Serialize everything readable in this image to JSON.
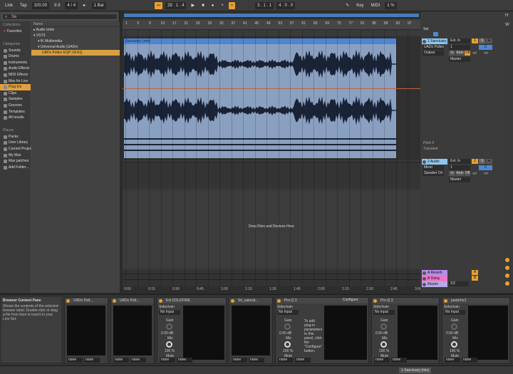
{
  "topbar": {
    "link": "Link",
    "tap": "Tap",
    "tempo": "100.00",
    "loop_icon": "II II",
    "signature": "4 / 4",
    "metro": "●·",
    "quant": "1 Bar",
    "position": "29 . 1 . 4",
    "loop_start": "3 . 1 . 1",
    "loop_len": "4 . 0 . 0",
    "key": "Key",
    "midi": "MIDI",
    "cpu": "1 %",
    "h": "H",
    "w": "W"
  },
  "browser": {
    "search_value": "Se",
    "collections_title": "Collections",
    "collections": [
      "Favorites"
    ],
    "categories_title": "Categories",
    "categories": [
      "Sounds",
      "Drums",
      "Instruments",
      "Audio Effects",
      "MIDI Effects",
      "Max for Live",
      "Plug-Ins",
      "Clips",
      "Samples",
      "Grooves",
      "Templates",
      "All results"
    ],
    "selected_category": "Plug-Ins",
    "places_title": "Places",
    "places": [
      "Packs",
      "User Library",
      "Current Project",
      "My Max",
      "Max patches",
      "Add Folder..."
    ],
    "tree_header": "Name",
    "tree": [
      {
        "label": "▸ Audio Units",
        "indent": 0
      },
      {
        "label": "▾ VST3",
        "indent": 0
      },
      {
        "label": "▾ IK Multimedia",
        "indent": 1
      },
      {
        "label": "▾ Universal Audio (UADx)",
        "indent": 1
      },
      {
        "label": "UADx Pultec EQP-1A EQ",
        "indent": 2,
        "selected": true
      }
    ]
  },
  "arrangement": {
    "bars": [
      "1",
      "5",
      "9",
      "13",
      "17",
      "21",
      "25",
      "29",
      "33",
      "37",
      "41",
      "45",
      "49",
      "53",
      "57",
      "61",
      "65",
      "69",
      "73",
      "77",
      "81",
      "85",
      "89",
      "93",
      "97"
    ],
    "clip_name": "Sanctuary (mix)",
    "drop_message": "Drop Files and Devices Here",
    "time_ticks": [
      "0:00",
      "0:15",
      "0:30",
      "0:45",
      "1:00",
      "1:15",
      "1:30",
      "1:45",
      "2:00",
      "2:15",
      "2:30",
      "2:45",
      "3:00"
    ]
  },
  "mixer": {
    "set_label": "Set",
    "track1": {
      "name": "1 Sanctuary",
      "io_in": "Ext. In",
      "device": "UADx Pultec",
      "ch": "1",
      "output": "Output",
      "in_auto": [
        "In",
        "Auto",
        "Off"
      ],
      "dest": "Master",
      "inf1": "-inf",
      "inf2": "-inf",
      "num": "1",
      "s": "S",
      "c": "C",
      "sub1": "Pitch 0",
      "sub2": "Transient"
    },
    "track2": {
      "name": "2 Audio",
      "io_in": "Ext. In",
      "device": "Mixer",
      "ch": "1",
      "output": "Speaker On",
      "in_auto": [
        "In",
        "Auto",
        "Off"
      ],
      "dest": "Master",
      "inf1": "-inf",
      "inf2": "-inf",
      "num": "2",
      "s": "S",
      "c": "C"
    },
    "returns": [
      {
        "name": "A Reverb",
        "letter": "A"
      },
      {
        "name": "B Delay",
        "letter": "B"
      },
      {
        "name": "Master",
        "letter": "1/2"
      }
    ],
    "colors": {
      "track1": "#8ec6f0",
      "track2": "#8ec6f0",
      "returnA": "#b88de8",
      "returnB": "#e878c8",
      "master": "#b8a8e8"
    }
  },
  "devices": {
    "info_title": "Browser Content Pane",
    "info_body": "Shows the contents of the selected browser label. Double-click or drag a file from here to load it in your Live Set.",
    "list": [
      {
        "name": "UADx Pult...",
        "type": "black",
        "foot": [
          "none",
          "none"
        ]
      },
      {
        "name": "UADx Pult...",
        "type": "black",
        "foot": [
          "none",
          "none"
        ]
      },
      {
        "name": "Ext COLDFIRE",
        "type": "knob",
        "sidechain": "Sidechain",
        "input": "No Input",
        "gain": "Gain",
        "db": "0.00 dB",
        "mix": "Mix",
        "pct": "100 %",
        "mute": "Mute",
        "foot": [
          "none",
          "none"
        ]
      },
      {
        "name": "Sir_saturat...",
        "type": "black",
        "foot": [
          "none",
          "none"
        ]
      },
      {
        "name": "Pro-Q 3",
        "type": "knob",
        "sidechain": "Sidechain",
        "input": "No Input",
        "gain": "Gain",
        "db": "0.00 dB",
        "mix": "Mix",
        "pct": "100 %",
        "mute": "Mute",
        "foot": [
          "none",
          "none"
        ],
        "configure": "Configure",
        "config_msg": "To add plug-in parameters to this panel, click the \"Configure\" button."
      },
      {
        "name": "Pro-Q 3",
        "type": "knob",
        "sidechain": "Sidechain",
        "input": "No Input",
        "gain": "Gain",
        "db": "0.00 dB",
        "mix": "Mix",
        "pct": "100 %",
        "mute": "Mute",
        "foot": [
          "none",
          "none"
        ]
      },
      {
        "name": "pastiche1",
        "type": "knob",
        "sidechain": "Sidechain",
        "input": "No Input",
        "gain": "Gain",
        "db": "0.00 dB",
        "mix": "Mix",
        "pct": "100 %",
        "mute": "Mute",
        "foot": [
          "none",
          "none"
        ]
      }
    ]
  },
  "status": {
    "selected_track": "1-Sanctuary (mix)"
  }
}
